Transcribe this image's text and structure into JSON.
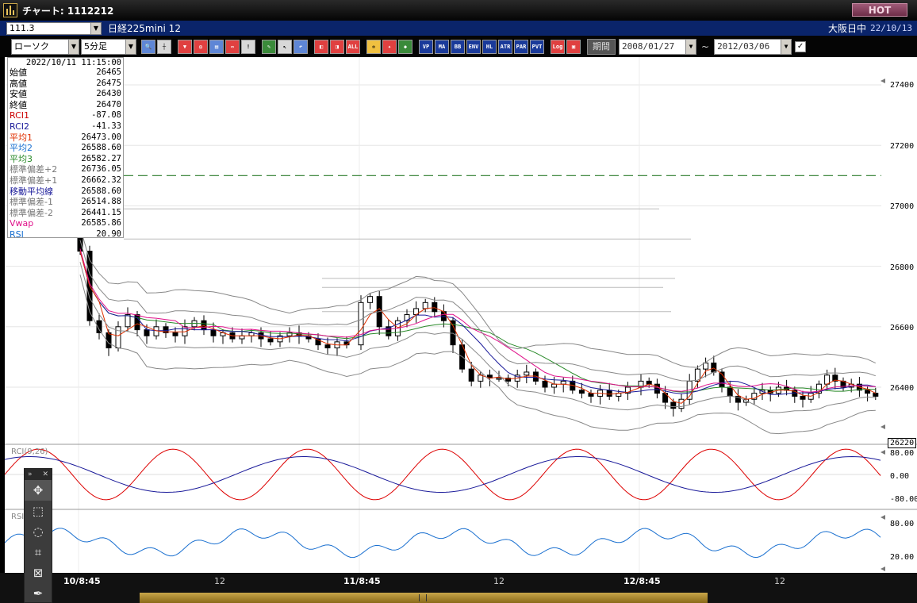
{
  "window": {
    "title": "チャート: 1112212",
    "hot_button": "HOT"
  },
  "row1": {
    "symbol": "111.3",
    "instrument": "日経225mini 12",
    "market": "大阪日中",
    "date": "22/10/13"
  },
  "toolbar": {
    "chart_type": "ローソク",
    "interval": "5分足",
    "buttons": [
      "search-icon",
      "crosshair-icon",
      "buy-icon",
      "zoom-icon",
      "chart-icon",
      "arrow-icon",
      "info-icon",
      "pencil-icon",
      "cursor-icon",
      "undo-icon",
      "bar-left-icon",
      "bar-right-icon",
      "ALL",
      "indicator-icon",
      "wrench-icon",
      "color-icon",
      "VP",
      "MA",
      "BB",
      "ENV",
      "HL",
      "ATR",
      "PAR",
      "PVT",
      "Log",
      "window-icon"
    ],
    "period_label": "期間",
    "date_from": "2008/01/27",
    "date_to": "2012/03/06",
    "tilde": "~"
  },
  "info": {
    "datetime": "2022/10/11 11:15:00",
    "rows": [
      {
        "label": "始値",
        "value": "26465",
        "color": "#000000"
      },
      {
        "label": "高値",
        "value": "26475",
        "color": "#000000"
      },
      {
        "label": "安値",
        "value": "26430",
        "color": "#000000"
      },
      {
        "label": "終値",
        "value": "26470",
        "color": "#000000"
      },
      {
        "label": "RCI1",
        "value": "-87.08",
        "color": "#cc0000"
      },
      {
        "label": "RCI2",
        "value": "-41.33",
        "color": "#1a1a9a"
      },
      {
        "label": "平均1",
        "value": "26473.00",
        "color": "#e03000"
      },
      {
        "label": "平均2",
        "value": "26588.60",
        "color": "#1a70d0"
      },
      {
        "label": "平均3",
        "value": "26582.27",
        "color": "#2a8a2a"
      },
      {
        "label": "標準偏差+2",
        "value": "26736.05",
        "color": "#777777"
      },
      {
        "label": "標準偏差+1",
        "value": "26662.32",
        "color": "#777777"
      },
      {
        "label": "移動平均線",
        "value": "26588.60",
        "color": "#1a1a9a"
      },
      {
        "label": "標準偏差-1",
        "value": "26514.88",
        "color": "#777777"
      },
      {
        "label": "標準偏差-2",
        "value": "26441.15",
        "color": "#777777"
      },
      {
        "label": "Vwap",
        "value": "26585.86",
        "color": "#e0108a"
      },
      {
        "label": "RSI",
        "value": "20.90",
        "color": "#1a70d0"
      }
    ]
  },
  "axes": {
    "price_ticks": [
      "27400",
      "27200",
      "27000",
      "26800",
      "26600",
      "26400"
    ],
    "current_price": "26220",
    "rci_ticks": [
      "80.00",
      "0.00",
      "-80.00"
    ],
    "rsi_ticks": [
      "80.00",
      "20.00"
    ],
    "x_labels": [
      {
        "text": "10/8:45",
        "bold": true
      },
      {
        "text": "12",
        "bold": false
      },
      {
        "text": "11/8:45",
        "bold": true
      },
      {
        "text": "12",
        "bold": false
      },
      {
        "text": "12/8:45",
        "bold": true
      },
      {
        "text": "12",
        "bold": false
      }
    ]
  },
  "panels": {
    "rci_name": "RCI(9,26)",
    "rsi_name": "RSI"
  },
  "palette": {
    "tools": [
      "move-icon",
      "marquee-icon",
      "lasso-icon",
      "crop-icon",
      "frame-icon",
      "brush-icon"
    ]
  },
  "chart_data": {
    "type": "candlestick",
    "ylim": [
      26200,
      27500
    ],
    "resistance_level": 27100,
    "close_path": [
      26850,
      26620,
      26580,
      26530,
      26600,
      26640,
      26590,
      26570,
      26600,
      26580,
      26570,
      26600,
      26620,
      26590,
      26570,
      26580,
      26560,
      26570,
      26580,
      26560,
      26550,
      26570,
      26580,
      26570,
      26560,
      26540,
      26530,
      26550,
      26540,
      26680,
      26700,
      26600,
      26570,
      26620,
      26640,
      26660,
      26680,
      26650,
      26620,
      26540,
      26460,
      26420,
      26440,
      26430,
      26430,
      26420,
      26440,
      26450,
      26420,
      26400,
      26410,
      26420,
      26390,
      26380,
      26370,
      26390,
      26370,
      26380,
      26400,
      26420,
      26410,
      26380,
      26350,
      26330,
      26360,
      26420,
      26460,
      26480,
      26450,
      26400,
      26370,
      26350,
      26360,
      26380,
      26390,
      26380,
      26400,
      26390,
      26370,
      26360,
      26380,
      26410,
      26440,
      26420,
      26400,
      26410,
      26390,
      26380,
      26370
    ]
  }
}
